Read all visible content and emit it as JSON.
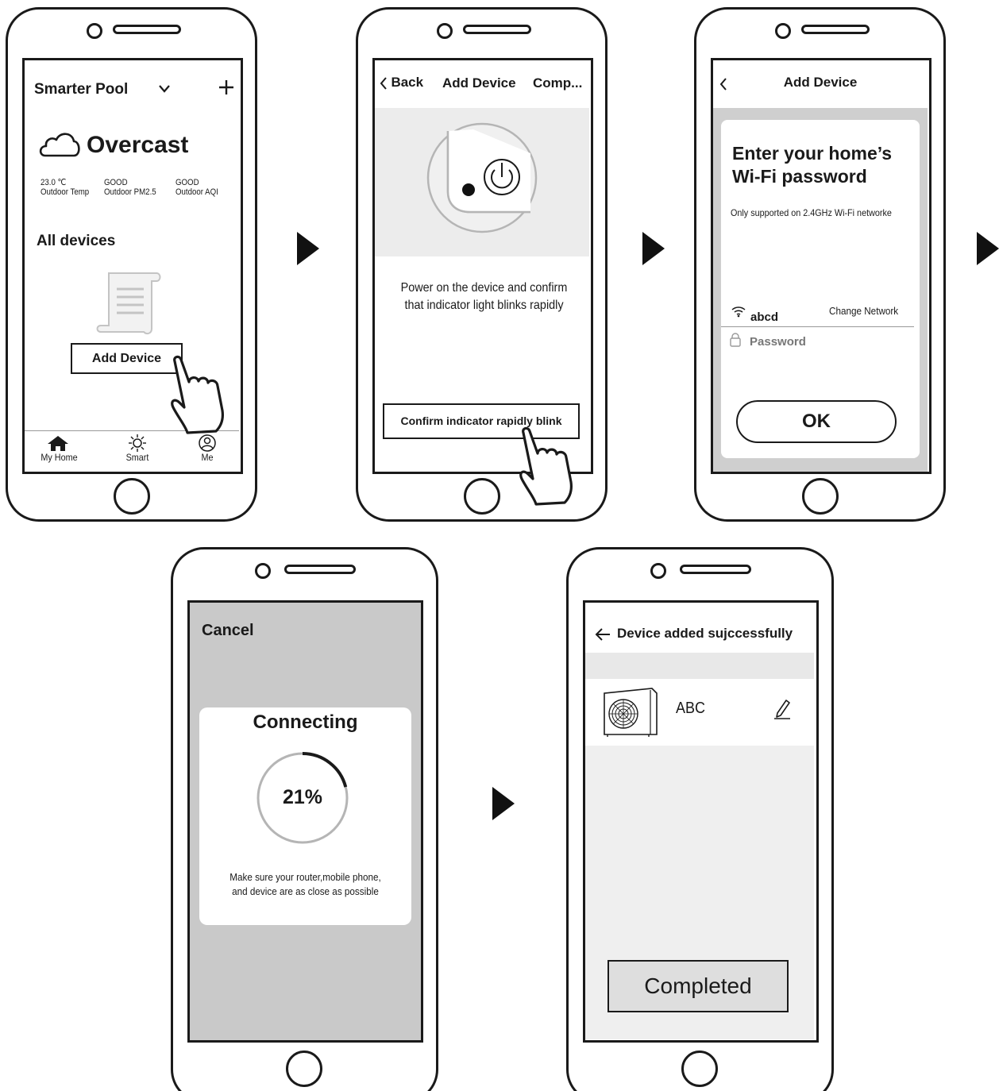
{
  "screen1": {
    "title": "Smarter Pool",
    "weather": "Overcast",
    "stats": [
      {
        "value": "23.0 ℃",
        "label": "Outdoor Temp"
      },
      {
        "value": "GOOD",
        "label": "Outdoor PM2.5"
      },
      {
        "value": "GOOD",
        "label": "Outdoor AQI"
      }
    ],
    "section": "All devices",
    "add_device": "Add Device",
    "tabs": [
      "My Home",
      "Smart",
      "Me"
    ]
  },
  "screen2": {
    "back": "Back",
    "title": "Add Device",
    "right": "Comp...",
    "instruction": "Power on the device and confirm that indicator light blinks rapidly",
    "confirm": "Confirm indicator rapidly blink"
  },
  "screen3": {
    "title": "Add Device",
    "heading_line1": "Enter your home’s",
    "heading_line2": "Wi-Fi password",
    "note": "Only supported on 2.4GHz Wi-Fi networke",
    "ssid": "abcd",
    "change": "Change Network",
    "password_placeholder": "Password",
    "ok": "OK"
  },
  "screen4": {
    "cancel": "Cancel",
    "title": "Connecting",
    "progress_text": "21%",
    "progress": 0.21,
    "hint_line1": "Make sure your router,mobile phone,",
    "hint_line2": "and device are as close as possible"
  },
  "screen5": {
    "title": "Device added sujccessfully",
    "device_name": "ABC",
    "completed": "Completed"
  },
  "colors": {
    "line": "#1a1a1a",
    "panel_grey": "#ececec",
    "overlay_grey": "#c9c9c9",
    "ring_grey": "#b5b5b5"
  }
}
